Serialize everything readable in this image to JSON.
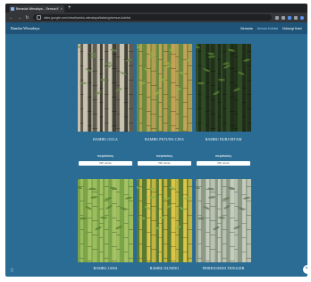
{
  "browser": {
    "tab_title": "Beranda Wimalaya – Semua Ko",
    "tab_close": "×",
    "new_tab": "+",
    "url": "sites.google.com/view/bambu-wimalaya/katalog/semua-koleksi",
    "back": "←",
    "forward": "→",
    "reload": "↻"
  },
  "site": {
    "brand": "Bambu Wimalaya",
    "nav": [
      "Beranda",
      "Semua Koleksi",
      "Hubungi Kami"
    ]
  },
  "products": [
    {
      "name": "BAMBU GULA",
      "sub": "Harga/batang",
      "select": "Pilih ukuran",
      "colors": {
        "bg": "#c9c2b0",
        "stalk": "#3b3a30",
        "leaf": "#6f8a4f"
      }
    },
    {
      "name": "BAMBU PETUNG CINA",
      "sub": "Harga/batang",
      "select": "Pilih ukuran",
      "colors": {
        "bg": "#6c8a3d",
        "stalk": "#c9a45a",
        "leaf": "#9bb24f"
      }
    },
    {
      "name": "BAMBU DURI HITAM",
      "sub": "Harga/batang",
      "select": "Pilih ukuran",
      "colors": {
        "bg": "#2f4a25",
        "stalk": "#1e2a18",
        "leaf": "#5f8a37"
      }
    },
    {
      "name": "BAMBU JAWA",
      "sub": "",
      "select": "",
      "colors": {
        "bg": "#7aa34a",
        "stalk": "#a8c566",
        "leaf": "#4f7a2a"
      }
    },
    {
      "name": "BAMBU KUNING",
      "sub": "",
      "select": "",
      "colors": {
        "bg": "#587a31",
        "stalk": "#e3c94a",
        "leaf": "#8fb04a"
      }
    },
    {
      "name": "PERHOUSEISI TENGGER",
      "sub": "",
      "select": "",
      "colors": {
        "bg": "#8c9a86",
        "stalk": "#c7cfc0",
        "leaf": "#5d7050"
      }
    }
  ],
  "icons": {
    "side": "▯",
    "fab": "✎"
  }
}
